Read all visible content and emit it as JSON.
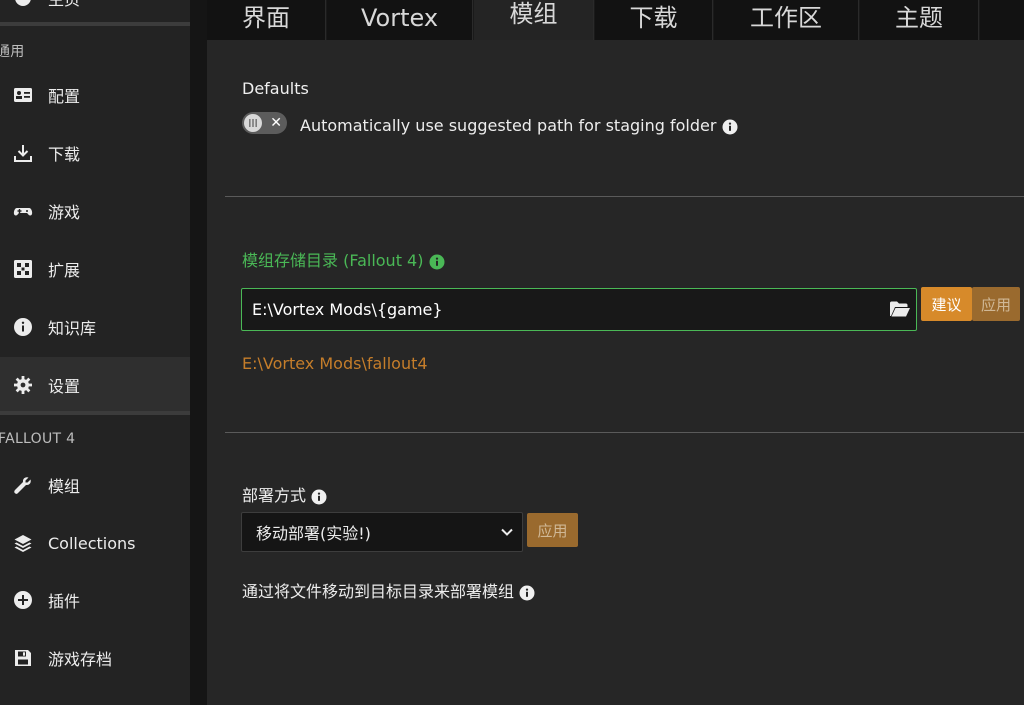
{
  "sidebar": {
    "top_partial_label": "主页",
    "group_general": "通用",
    "items": [
      {
        "label": "配置",
        "icon": "profile-card-icon"
      },
      {
        "label": "下载",
        "icon": "download-icon"
      },
      {
        "label": "游戏",
        "icon": "gamepad-icon"
      },
      {
        "label": "扩展",
        "icon": "extensions-icon"
      },
      {
        "label": "知识库",
        "icon": "info-circle-icon"
      },
      {
        "label": "设置",
        "icon": "gear-icon",
        "active": true
      }
    ],
    "group_game": "FALLOUT 4",
    "game_items": [
      {
        "label": "模组",
        "icon": "wrench-icon"
      },
      {
        "label": "Collections",
        "icon": "layers-icon"
      },
      {
        "label": "插件",
        "icon": "plus-circle-icon"
      },
      {
        "label": "游戏存档",
        "icon": "save-icon"
      }
    ]
  },
  "tabs": [
    {
      "label": "界面"
    },
    {
      "label": "Vortex"
    },
    {
      "label": "模组",
      "active": true
    },
    {
      "label": "下载"
    },
    {
      "label": "工作区"
    },
    {
      "label": "主题"
    }
  ],
  "defaults": {
    "title": "Defaults",
    "toggle_label": "Automatically use suggested path for staging folder",
    "toggle_on": false
  },
  "staging": {
    "title": "模组存储目录 (Fallout 4)",
    "input_value": "E:\\Vortex Mods\\{game}",
    "suggest_button": "建议",
    "apply_button": "应用",
    "resolved_path": "E:\\Vortex Mods\\fallout4"
  },
  "deploy": {
    "title": "部署方式",
    "selected_option": "移动部署(实验!)",
    "apply_button": "应用",
    "description": "通过将文件移动到目标目录来部署模组"
  },
  "colors": {
    "accent_green": "#4ab856",
    "accent_orange": "#d78a2a",
    "path_orange": "#c57d2a"
  }
}
